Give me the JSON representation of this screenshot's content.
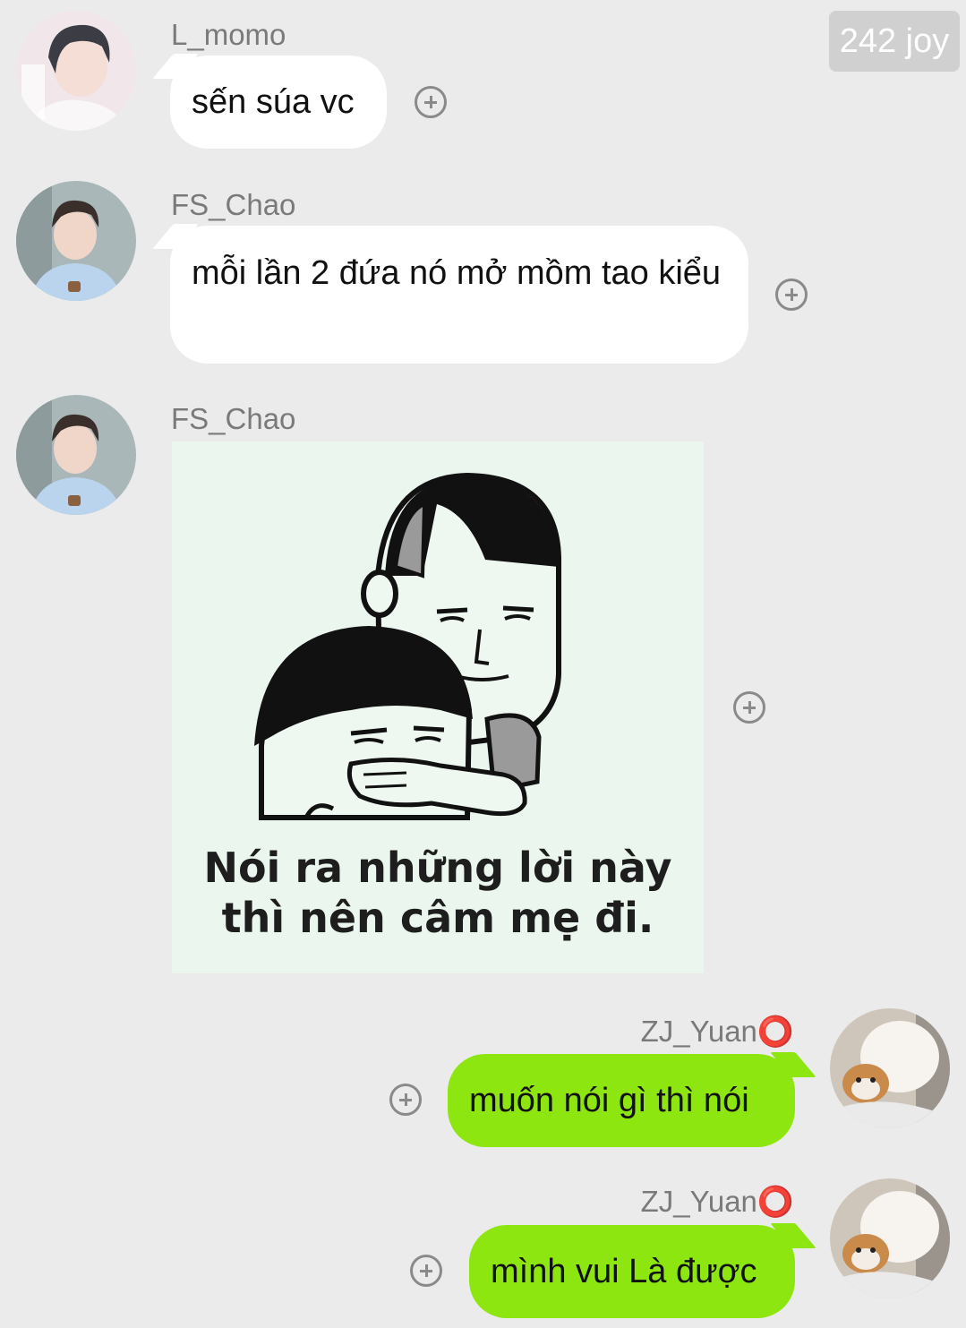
{
  "badge": "242 joy",
  "messages": [
    {
      "sender": "L_momo",
      "text": "sến súa vc",
      "direction": "incoming",
      "avatar": "avatar-person"
    },
    {
      "sender": "FS_Chao",
      "text": "mỗi lần 2 đứa nó mở mồm tao kiểu",
      "direction": "incoming",
      "avatar": "avatar-person"
    },
    {
      "sender": "FS_Chao",
      "direction": "incoming",
      "type": "image",
      "avatar": "avatar-person",
      "caption_line1": "Nói ra những lời này",
      "caption_line2": "thì nên câm mẹ đi."
    },
    {
      "sender": "ZJ_Yuan⭕",
      "text": "muốn nói gì thì nói",
      "direction": "outgoing",
      "avatar": "avatar-cat"
    },
    {
      "sender": "ZJ_Yuan⭕",
      "text": "mình vui Là được",
      "direction": "outgoing",
      "avatar": "avatar-cat"
    }
  ],
  "colors": {
    "background": "#ebebeb",
    "incoming_bubble": "#ffffff",
    "outgoing_bubble": "#8ee610",
    "badge": "#d0d0d0"
  },
  "icons": [
    "add-circle-icon"
  ]
}
